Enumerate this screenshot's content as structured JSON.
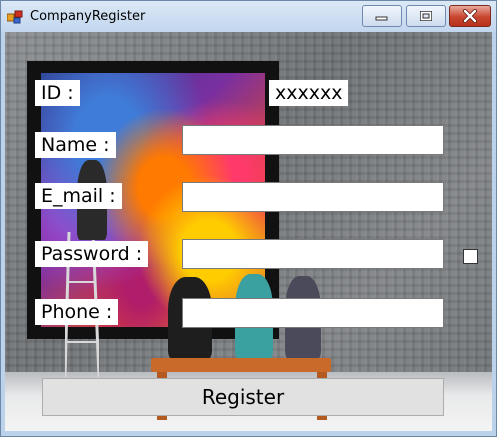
{
  "window": {
    "title": "CompanyRegister",
    "controls": {
      "minimize": "minimize-icon",
      "maximize": "maximize-icon",
      "close": "close-icon"
    }
  },
  "form": {
    "id_label": "ID :",
    "id_value": "xxxxxx",
    "name_label": "Name :",
    "name_value": "",
    "email_label": "E_mail :",
    "email_value": "",
    "password_label": "Password :",
    "password_value": "",
    "show_password_checked": false,
    "phone_label": "Phone :",
    "phone_value": "",
    "register_button": "Register"
  },
  "colors": {
    "label_bg": "#ffffff",
    "close_button": "#c8462f",
    "bench": "#c9692a"
  }
}
